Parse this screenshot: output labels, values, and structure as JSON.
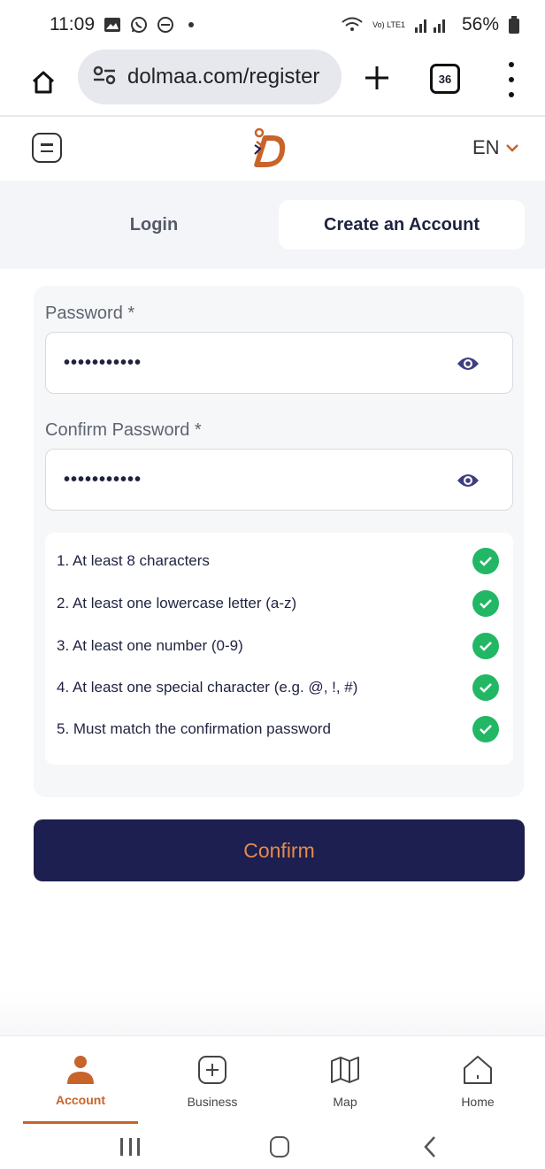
{
  "status_bar": {
    "time": "11:09",
    "battery": "56%",
    "network": "Vo) LTE1"
  },
  "browser": {
    "url": "dolmaa.com/register",
    "tab_count": "36"
  },
  "header": {
    "language": "EN",
    "brand_color": "#c8632a"
  },
  "tabs": {
    "login": "Login",
    "create_account": "Create an Account"
  },
  "form": {
    "password_label": "Password *",
    "password_value": "•••••••••••",
    "confirm_label": "Confirm Password *",
    "confirm_value": "•••••••••••",
    "rules": [
      {
        "text": "1. At least 8 characters",
        "met": true
      },
      {
        "text": "2. At least one lowercase letter (a-z)",
        "met": true
      },
      {
        "text": "3. At least one number (0-9)",
        "met": true
      },
      {
        "text": "4. At least one special character (e.g. @, !, #)",
        "met": true
      },
      {
        "text": "5. Must match the confirmation password",
        "met": true
      }
    ],
    "confirm_button": "Confirm"
  },
  "bottom_nav": {
    "items": [
      {
        "label": "Account",
        "icon": "person-icon",
        "active": true
      },
      {
        "label": "Business",
        "icon": "plus-square-icon",
        "active": false
      },
      {
        "label": "Map",
        "icon": "map-icon",
        "active": false
      },
      {
        "label": "Home",
        "icon": "home-icon",
        "active": false
      }
    ]
  },
  "colors": {
    "primary": "#1c1f4f",
    "accent": "#e58a4c",
    "success": "#22b765"
  }
}
